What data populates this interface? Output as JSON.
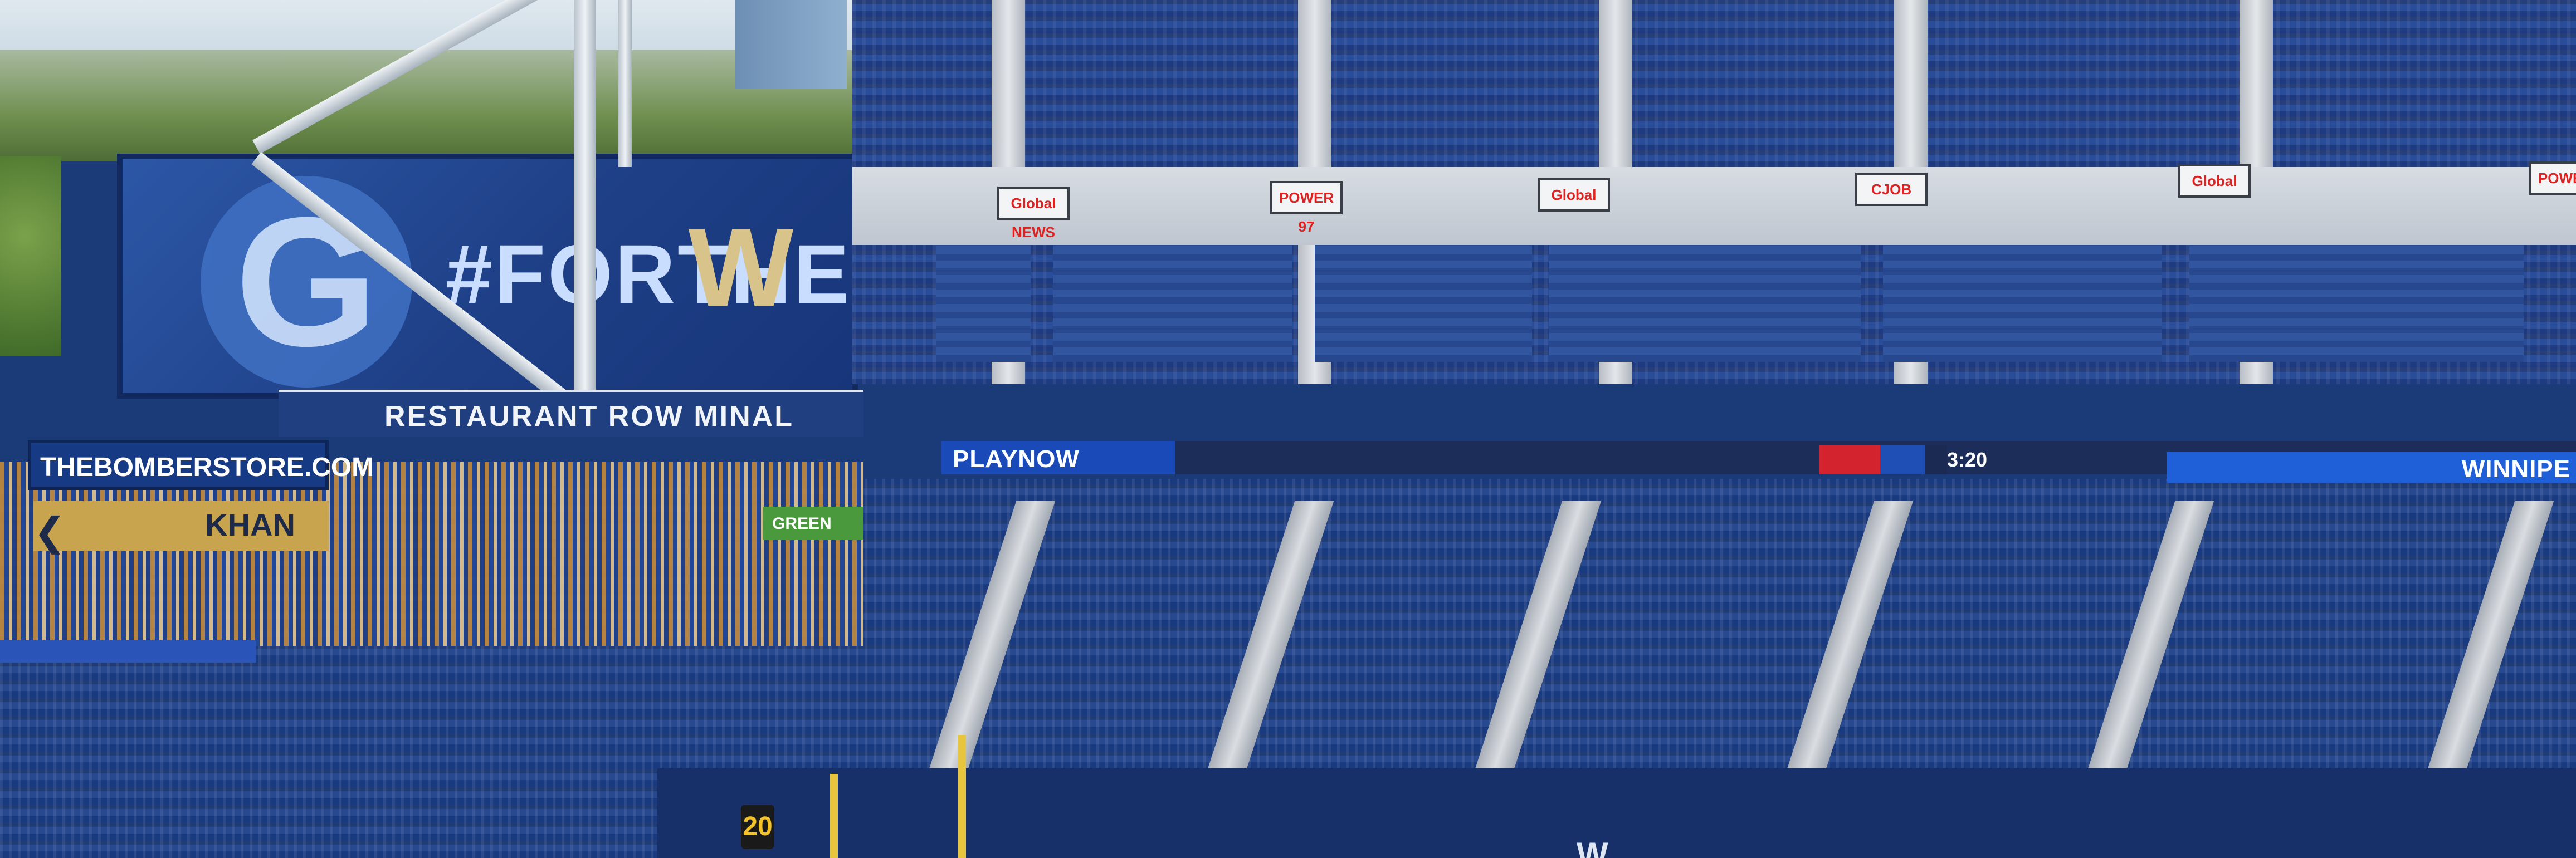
{
  "billboard": {
    "hashtag": "#FORTHE",
    "team_letter": "W",
    "logo_letter": "G"
  },
  "terminal_band": {
    "text": "RESTAURANT ROW  MINAL"
  },
  "store_sign": {
    "text": "THEBOMBERSTORE.COM"
  },
  "khan_sign": {
    "text": "KHAN"
  },
  "green_ad": {
    "text": "GREEN"
  },
  "upper_signs": [
    "Global NEWS",
    "POWER 97",
    "Global",
    "CJOB",
    "Global",
    "POWER"
  ],
  "ribbon": {
    "playnow": "PLAYNOW",
    "game_clock": "3:20",
    "right_text": "WINNIPE"
  },
  "field": {
    "yard_marker": "20",
    "wall_letter": "W"
  },
  "colors": {
    "bomber_blue": "#1f4fb4",
    "bomber_gold": "#c7a44d",
    "red": "#d3232f"
  }
}
